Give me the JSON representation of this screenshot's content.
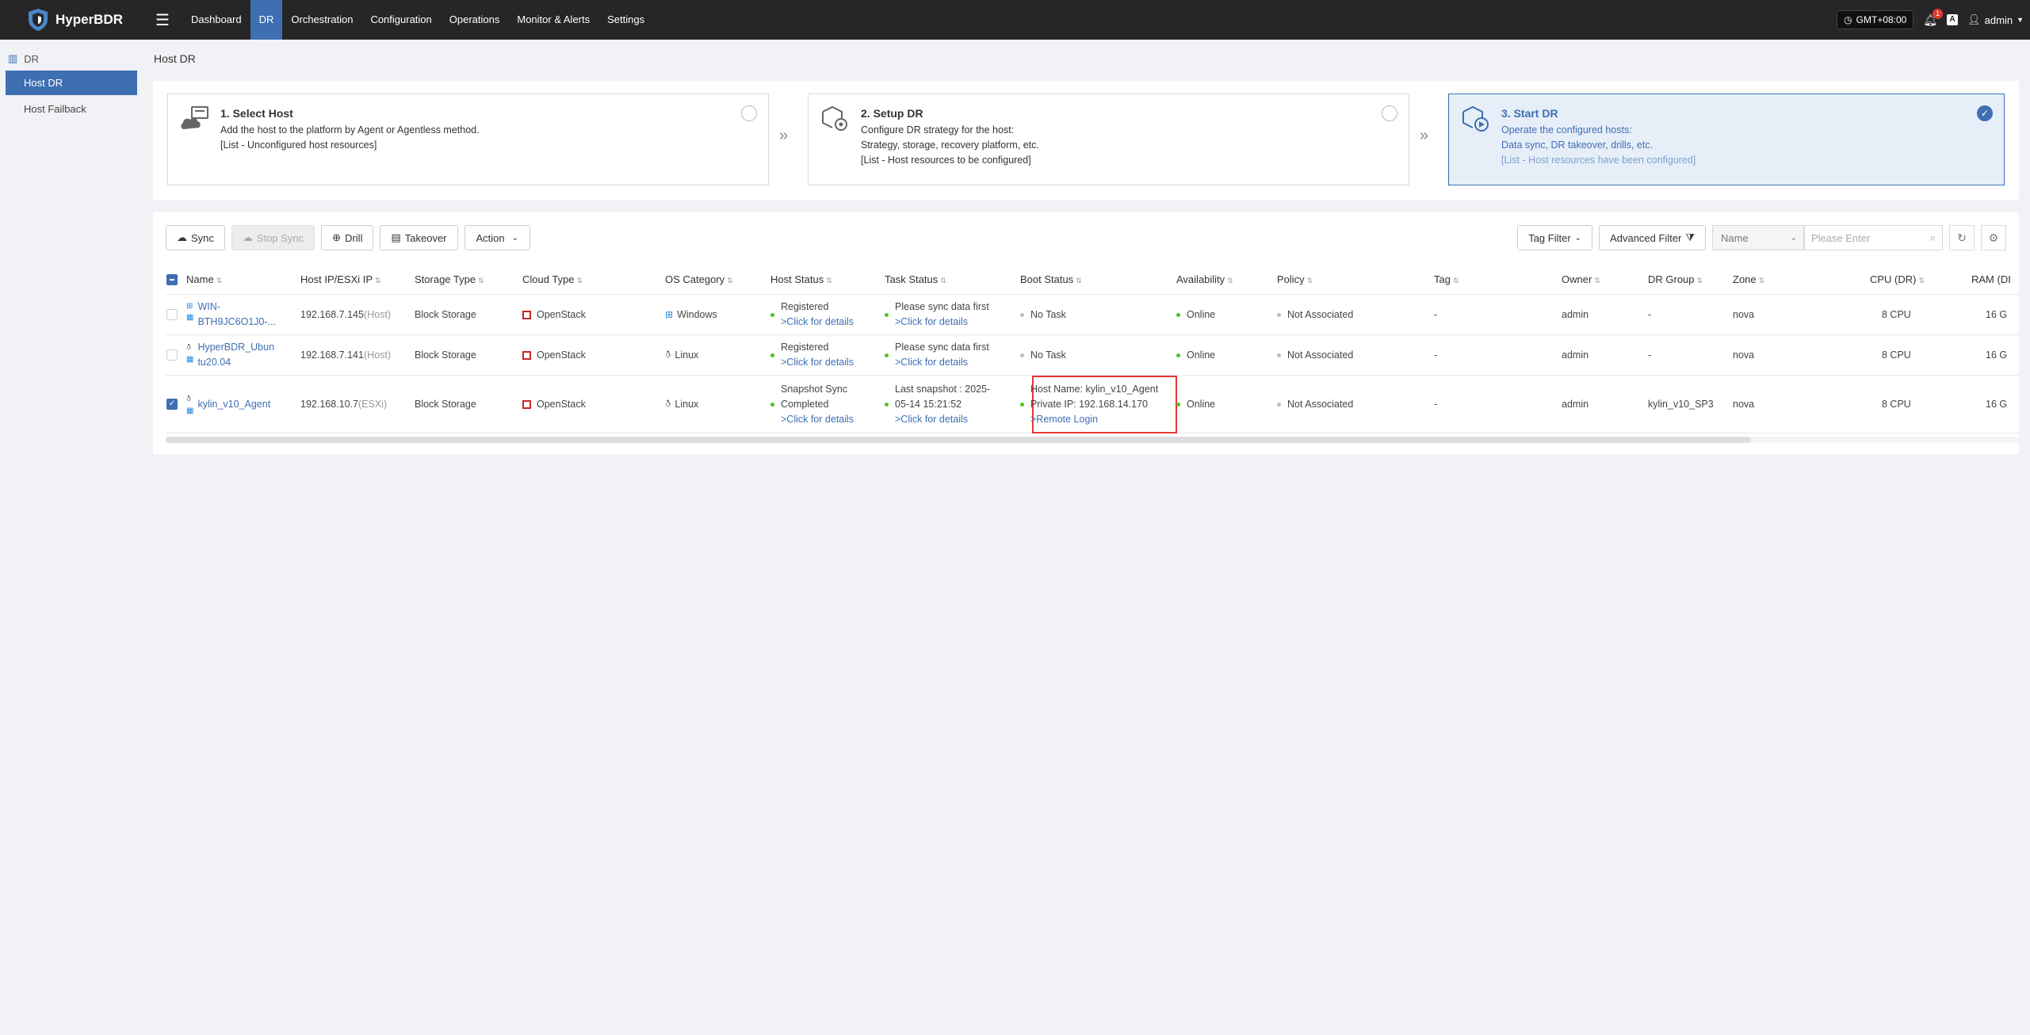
{
  "app": {
    "name": "HyperBDR"
  },
  "nav": {
    "items": [
      "Dashboard",
      "DR",
      "Orchestration",
      "Configuration",
      "Operations",
      "Monitor & Alerts",
      "Settings"
    ],
    "active": "DR"
  },
  "topRight": {
    "timezone": "GMT+08:00",
    "notifications": "1",
    "lang": "A",
    "user": "admin"
  },
  "sidebar": {
    "group": "DR",
    "items": [
      {
        "label": "Host DR",
        "active": true
      },
      {
        "label": "Host Failback",
        "active": false
      }
    ]
  },
  "page": {
    "title": "Host DR"
  },
  "steps": [
    {
      "title": "1. Select Host",
      "line1": "Add the host to the platform by Agent or Agentless method.",
      "line2": "",
      "note": "[List - Unconfigured host resources]",
      "checked": false
    },
    {
      "title": "2. Setup DR",
      "line1": "Configure DR strategy for the host:",
      "line2": "Strategy, storage, recovery platform, etc.",
      "note": "[List - Host resources to be configured]",
      "checked": false
    },
    {
      "title": "3. Start DR",
      "line1": "Operate the configured hosts:",
      "line2": "Data sync, DR takeover, drills, etc.",
      "note": "[List - Host resources have been configured]",
      "checked": true
    }
  ],
  "toolbar": {
    "sync": "Sync",
    "stop_sync": "Stop Sync",
    "drill": "Drill",
    "takeover": "Takeover",
    "action": "Action",
    "tag_filter": "Tag Filter",
    "advanced_filter": "Advanced Filter",
    "search_field": "Name",
    "search_placeholder": "Please Enter"
  },
  "table": {
    "columns": [
      "Name",
      "Host IP/ESXi IP",
      "Storage Type",
      "Cloud Type",
      "OS Category",
      "Host Status",
      "Task Status",
      "Boot Status",
      "Availability",
      "Policy",
      "Tag",
      "Owner",
      "DR Group",
      "Zone",
      "CPU (DR)",
      "RAM (DI"
    ],
    "rows": [
      {
        "checked": false,
        "name_l1": "WIN-",
        "name_l2": "BTH9JC6O1J0-...",
        "ip": "192.168.7.145",
        "ip_type": "(Host)",
        "storage": "Block Storage",
        "cloud": "OpenStack",
        "os": "Windows",
        "host_status_l1": "Registered",
        "host_status_l2": "",
        "host_status_link": ">Click for details",
        "task_l1": "Please sync data first",
        "task_l2": "",
        "task_link": ">Click for details",
        "boot_l1": "No Task",
        "boot_l2": "",
        "boot_link": "",
        "availability": "Online",
        "policy": "Not Associated",
        "tag": "-",
        "owner": "admin",
        "dr_group": "-",
        "zone": "nova",
        "cpu": "8 CPU",
        "ram": "16 G"
      },
      {
        "checked": false,
        "name_l1": "HyperBDR_Ubun",
        "name_l2": "tu20.04",
        "ip": "192.168.7.141",
        "ip_type": "(Host)",
        "storage": "Block Storage",
        "cloud": "OpenStack",
        "os": "Linux",
        "host_status_l1": "Registered",
        "host_status_l2": "",
        "host_status_link": ">Click for details",
        "task_l1": "Please sync data first",
        "task_l2": "",
        "task_link": ">Click for details",
        "boot_l1": "No Task",
        "boot_l2": "",
        "boot_link": "",
        "availability": "Online",
        "policy": "Not Associated",
        "tag": "-",
        "owner": "admin",
        "dr_group": "-",
        "zone": "nova",
        "cpu": "8 CPU",
        "ram": "16 G"
      },
      {
        "checked": true,
        "name_l1": "kylin_v10_Agent",
        "name_l2": "",
        "ip": "192.168.10.7",
        "ip_type": "(ESXi)",
        "storage": "Block Storage",
        "cloud": "OpenStack",
        "os": "Linux",
        "host_status_l1": "Snapshot Sync",
        "host_status_l2": "Completed",
        "host_status_link": ">Click for details",
        "task_l1": "Last snapshot : 2025-",
        "task_l2": "05-14 15:21:52",
        "task_link": ">Click for details",
        "boot_l1": "Host Name: kylin_v10_Agent",
        "boot_l2": "Private IP: 192.168.14.170",
        "boot_link": ">Remote Login",
        "availability": "Online",
        "policy": "Not Associated",
        "tag": "-",
        "owner": "admin",
        "dr_group": "kylin_v10_SP3",
        "zone": "nova",
        "cpu": "8 CPU",
        "ram": "16 G"
      }
    ]
  },
  "colors": {
    "accent": "#3e6fb3",
    "topbar": "#262626",
    "online": "#52c41a",
    "highlight": "#e53935",
    "cloud": "#c62828"
  }
}
